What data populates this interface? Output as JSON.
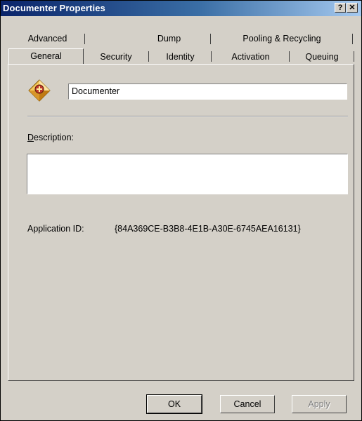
{
  "window": {
    "title": "Documenter Properties",
    "help_label": "?",
    "close_label": "✕"
  },
  "tabs": {
    "back": [
      {
        "label": "Advanced"
      },
      {
        "label": "Dump"
      },
      {
        "label": "Pooling & Recycling"
      }
    ],
    "front": [
      {
        "label": "General",
        "active": true
      },
      {
        "label": "Security"
      },
      {
        "label": "Identity"
      },
      {
        "label": "Activation"
      },
      {
        "label": "Queuing"
      }
    ]
  },
  "general": {
    "app_icon": "com-application-package-icon",
    "name_value": "Documenter",
    "description_label_accel": "D",
    "description_label_rest": "escription:",
    "description_value": "",
    "app_id_label": "Application ID:",
    "app_id_value": "{84A369CE-B3B8-4E1B-A30E-6745AEA16131}"
  },
  "buttons": {
    "ok": "OK",
    "cancel": "Cancel",
    "apply": "Apply"
  },
  "colors": {
    "titlebar_start": "#0a246a",
    "titlebar_end": "#a6caf0",
    "face": "#d4d0c8",
    "disabled_text": "#808080"
  }
}
